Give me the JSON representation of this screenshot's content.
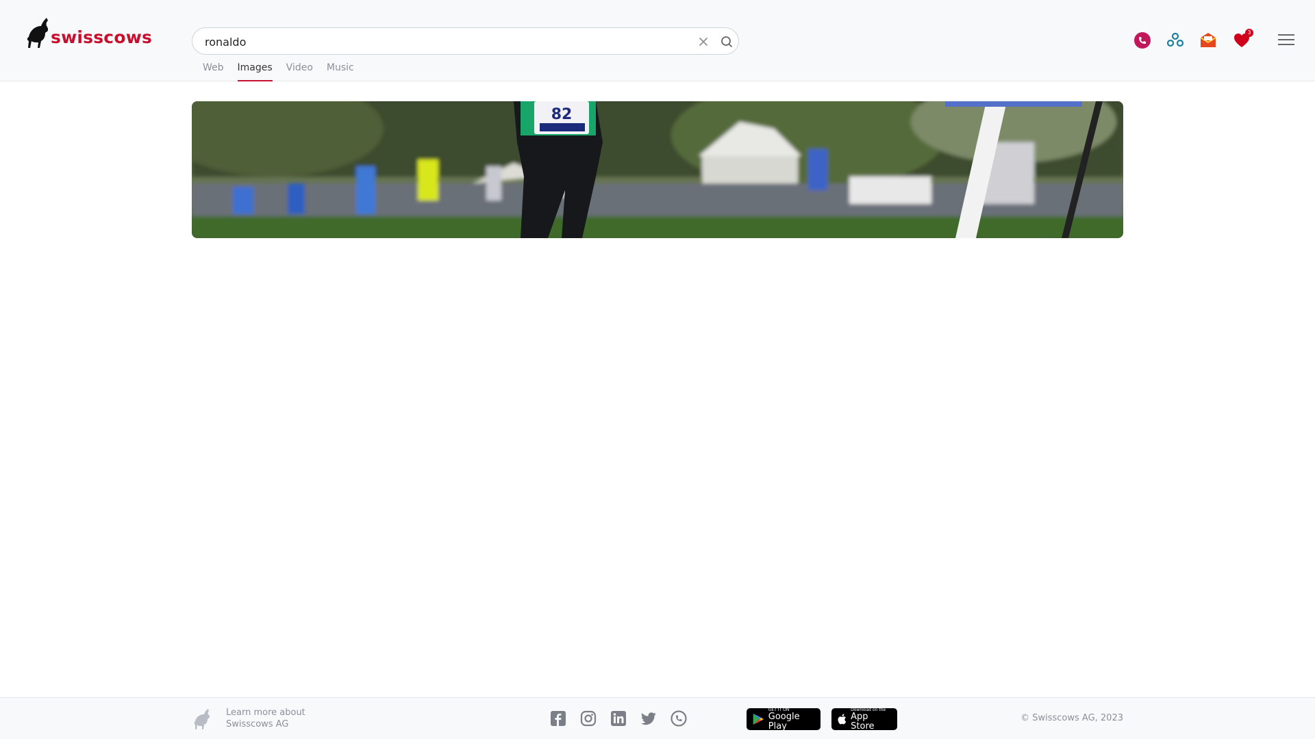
{
  "brand": {
    "name": "swisscows",
    "accent": "#c8102e"
  },
  "search": {
    "value": "ronaldo",
    "placeholder": ""
  },
  "tabs": [
    {
      "label": "Web",
      "active": false
    },
    {
      "label": "Images",
      "active": true
    },
    {
      "label": "Video",
      "active": false
    },
    {
      "label": "Music",
      "active": false
    }
  ],
  "header_icons": [
    {
      "name": "teleguard-icon",
      "color": "#c2185b"
    },
    {
      "name": "vpn-icon",
      "color": "#1b7f9e"
    },
    {
      "name": "email-icon",
      "color": "#e5481f"
    },
    {
      "name": "heart-icon",
      "color": "#d0021b"
    }
  ],
  "notifications": {
    "count": "3"
  },
  "result": {
    "bib_number": "82",
    "description": "athletics runner photo thumbnail"
  },
  "footer": {
    "learn_more_line1": "Learn more about",
    "learn_more_line2": "Swisscows AG",
    "social": [
      "facebook-icon",
      "instagram-icon",
      "linkedin-icon",
      "twitter-icon",
      "teleguard-icon"
    ],
    "google_play_small": "GET IT ON",
    "google_play_big": "Google Play",
    "app_store_small": "Download on the",
    "app_store_big": "App Store",
    "copyright": "© Swisscows AG, 2023"
  }
}
